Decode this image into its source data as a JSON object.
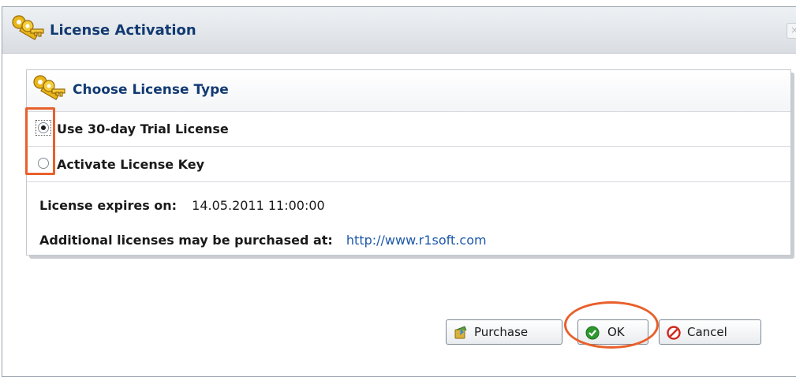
{
  "dialog": {
    "title": "License Activation",
    "icon": "keys-icon",
    "close_icon": "close-icon"
  },
  "panel": {
    "title": "Choose License Type",
    "icon": "keys-icon",
    "options": [
      {
        "label": "Use 30-day Trial License",
        "selected": true
      },
      {
        "label": "Activate License Key",
        "selected": false
      }
    ],
    "expires_label": "License expires on:",
    "expires_value": "14.05.2011 11:00:00",
    "purchase_text": "Additional licenses may be purchased at:",
    "purchase_link": "http://www.r1soft.com"
  },
  "buttons": {
    "purchase": {
      "label": "Purchase",
      "icon": "purchase-icon"
    },
    "ok": {
      "label": "OK",
      "icon": "checkmark-icon"
    },
    "cancel": {
      "label": "Cancel",
      "icon": "cancel-icon"
    }
  },
  "colors": {
    "title": "#123a72",
    "link": "#1c58a8",
    "highlight": "#e8602b",
    "ok_green": "#2e9a2e",
    "cancel_red": "#d0281e"
  }
}
